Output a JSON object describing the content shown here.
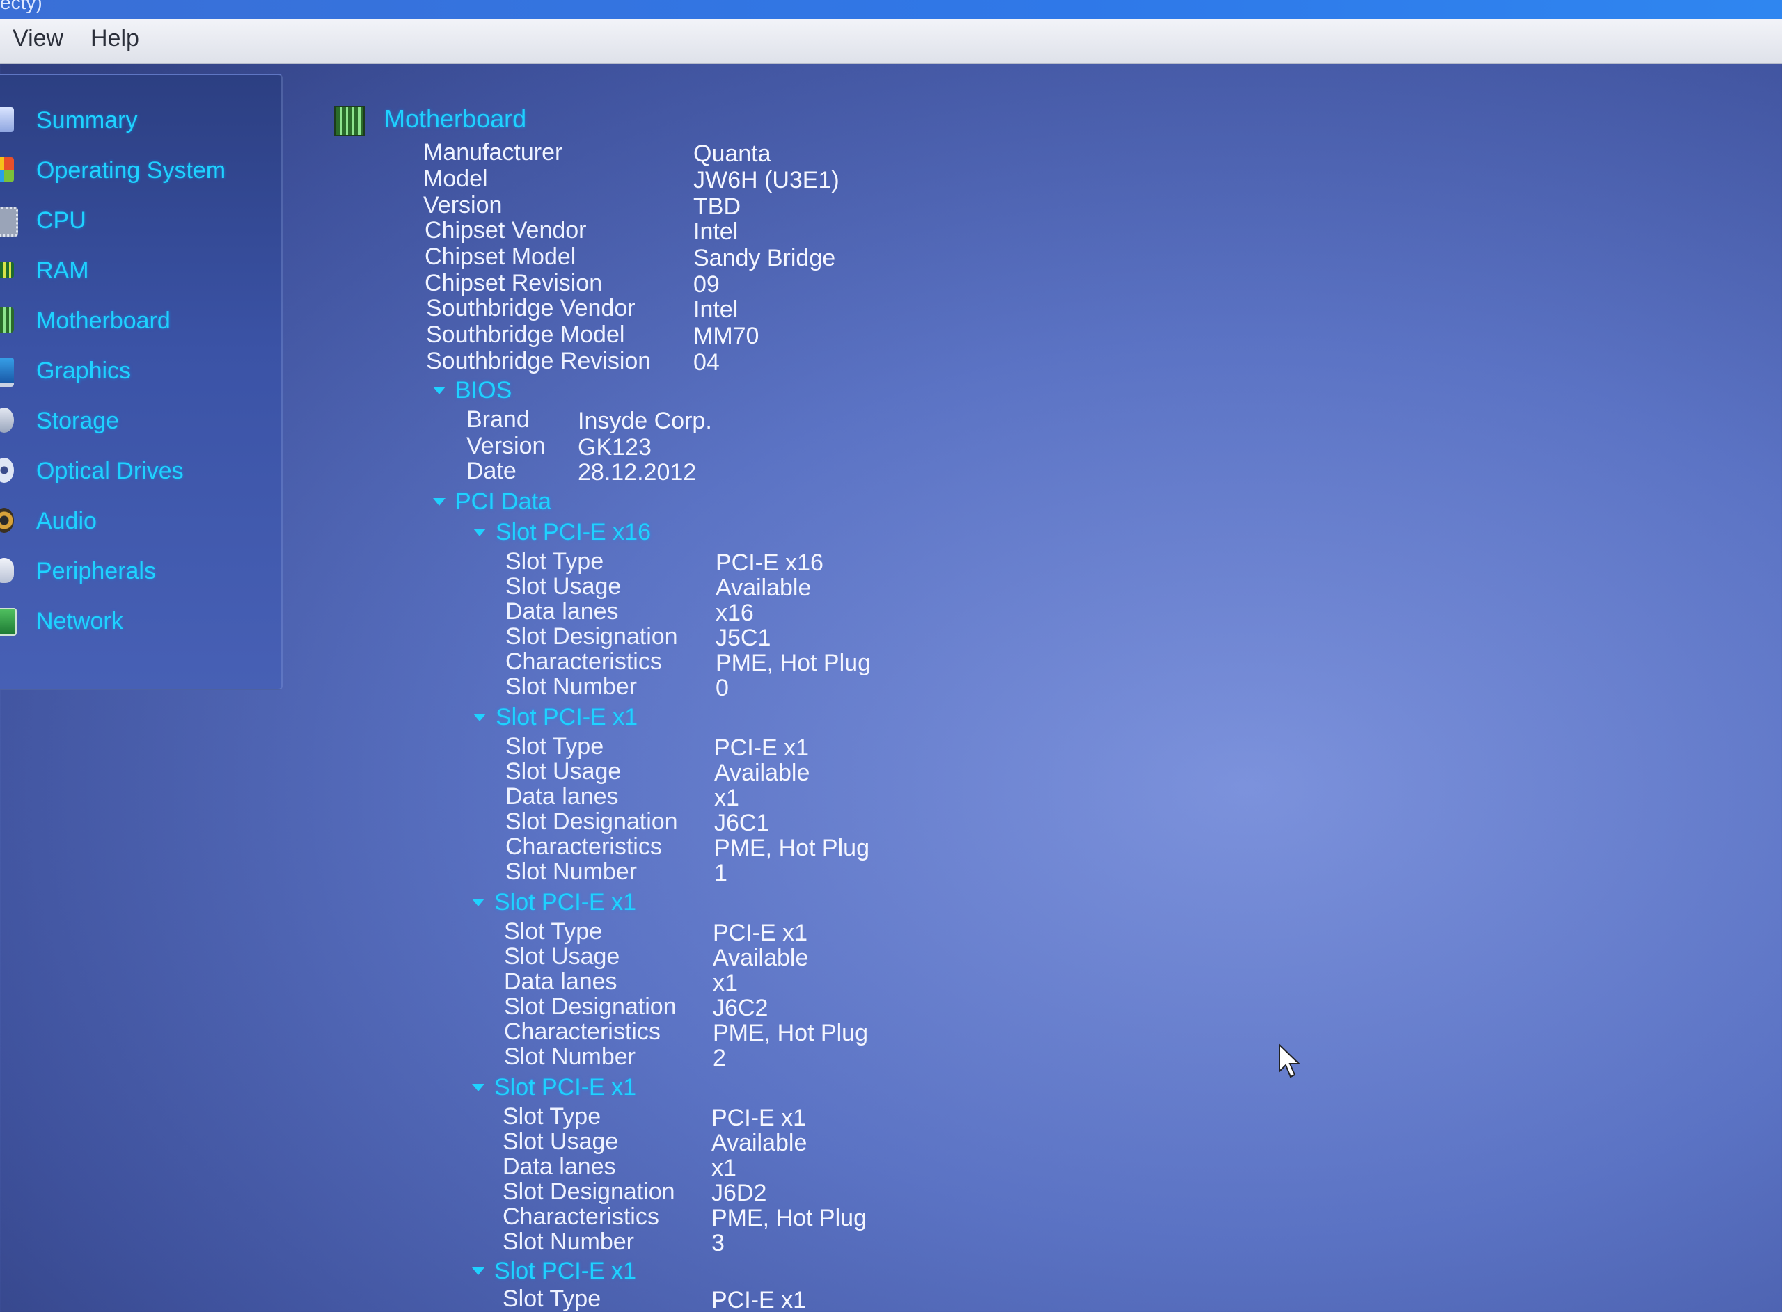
{
  "window": {
    "title_fragment": "ecty)"
  },
  "menu": [
    {
      "label": "View"
    },
    {
      "label": "Help"
    }
  ],
  "sidebar": {
    "items": [
      {
        "label": "Summary",
        "icon": "summary-icon"
      },
      {
        "label": "Operating System",
        "icon": "os-icon"
      },
      {
        "label": "CPU",
        "icon": "cpu-icon"
      },
      {
        "label": "RAM",
        "icon": "ram-icon"
      },
      {
        "label": "Motherboard",
        "icon": "motherboard-icon"
      },
      {
        "label": "Graphics",
        "icon": "graphics-icon"
      },
      {
        "label": "Storage",
        "icon": "storage-icon"
      },
      {
        "label": "Optical Drives",
        "icon": "optical-drive-icon"
      },
      {
        "label": "Audio",
        "icon": "audio-icon"
      },
      {
        "label": "Peripherals",
        "icon": "peripherals-icon"
      },
      {
        "label": "Network",
        "icon": "network-icon"
      }
    ]
  },
  "motherboard": {
    "title": "Motherboard",
    "props": [
      {
        "label": "Manufacturer",
        "value": "Quanta"
      },
      {
        "label": "Model",
        "value": "JW6H (U3E1)"
      },
      {
        "label": "Version",
        "value": "TBD"
      },
      {
        "label": "Chipset Vendor",
        "value": "Intel"
      },
      {
        "label": "Chipset Model",
        "value": "Sandy Bridge"
      },
      {
        "label": "Chipset Revision",
        "value": "09"
      },
      {
        "label": "Southbridge Vendor",
        "value": "Intel"
      },
      {
        "label": "Southbridge Model",
        "value": "MM70"
      },
      {
        "label": "Southbridge Revision",
        "value": "04"
      }
    ],
    "bios": {
      "title": "BIOS",
      "props": [
        {
          "label": "Brand",
          "value": "Insyde Corp."
        },
        {
          "label": "Version",
          "value": "GK123"
        },
        {
          "label": "Date",
          "value": "28.12.2012"
        }
      ]
    },
    "pci": {
      "title": "PCI Data",
      "slots": [
        {
          "title": "Slot PCI-E x16",
          "props": [
            {
              "label": "Slot Type",
              "value": "PCI-E x16"
            },
            {
              "label": "Slot Usage",
              "value": "Available"
            },
            {
              "label": "Data lanes",
              "value": "x16"
            },
            {
              "label": "Slot Designation",
              "value": "J5C1"
            },
            {
              "label": "Characteristics",
              "value": "PME, Hot Plug"
            },
            {
              "label": "Slot Number",
              "value": "0"
            }
          ]
        },
        {
          "title": "Slot PCI-E x1",
          "props": [
            {
              "label": "Slot Type",
              "value": "PCI-E x1"
            },
            {
              "label": "Slot Usage",
              "value": "Available"
            },
            {
              "label": "Data lanes",
              "value": "x1"
            },
            {
              "label": "Slot Designation",
              "value": "J6C1"
            },
            {
              "label": "Characteristics",
              "value": "PME, Hot Plug"
            },
            {
              "label": "Slot Number",
              "value": "1"
            }
          ]
        },
        {
          "title": "Slot PCI-E x1",
          "props": [
            {
              "label": "Slot Type",
              "value": "PCI-E x1"
            },
            {
              "label": "Slot Usage",
              "value": "Available"
            },
            {
              "label": "Data lanes",
              "value": "x1"
            },
            {
              "label": "Slot Designation",
              "value": "J6C2"
            },
            {
              "label": "Characteristics",
              "value": "PME, Hot Plug"
            },
            {
              "label": "Slot Number",
              "value": "2"
            }
          ]
        },
        {
          "title": "Slot PCI-E x1",
          "props": [
            {
              "label": "Slot Type",
              "value": "PCI-E x1"
            },
            {
              "label": "Slot Usage",
              "value": "Available"
            },
            {
              "label": "Data lanes",
              "value": "x1"
            },
            {
              "label": "Slot Designation",
              "value": "J6D2"
            },
            {
              "label": "Characteristics",
              "value": "PME, Hot Plug"
            },
            {
              "label": "Slot Number",
              "value": "3"
            }
          ]
        },
        {
          "title": "Slot PCI-E x1",
          "props": [
            {
              "label": "Slot Type",
              "value": "PCI-E x1"
            }
          ]
        }
      ]
    }
  },
  "colors": {
    "accent_text": "#1fd2ff",
    "plain_text": "#eef2ff",
    "title_bar": "#2f78e8",
    "menu_bar": "#e9ebf2"
  }
}
